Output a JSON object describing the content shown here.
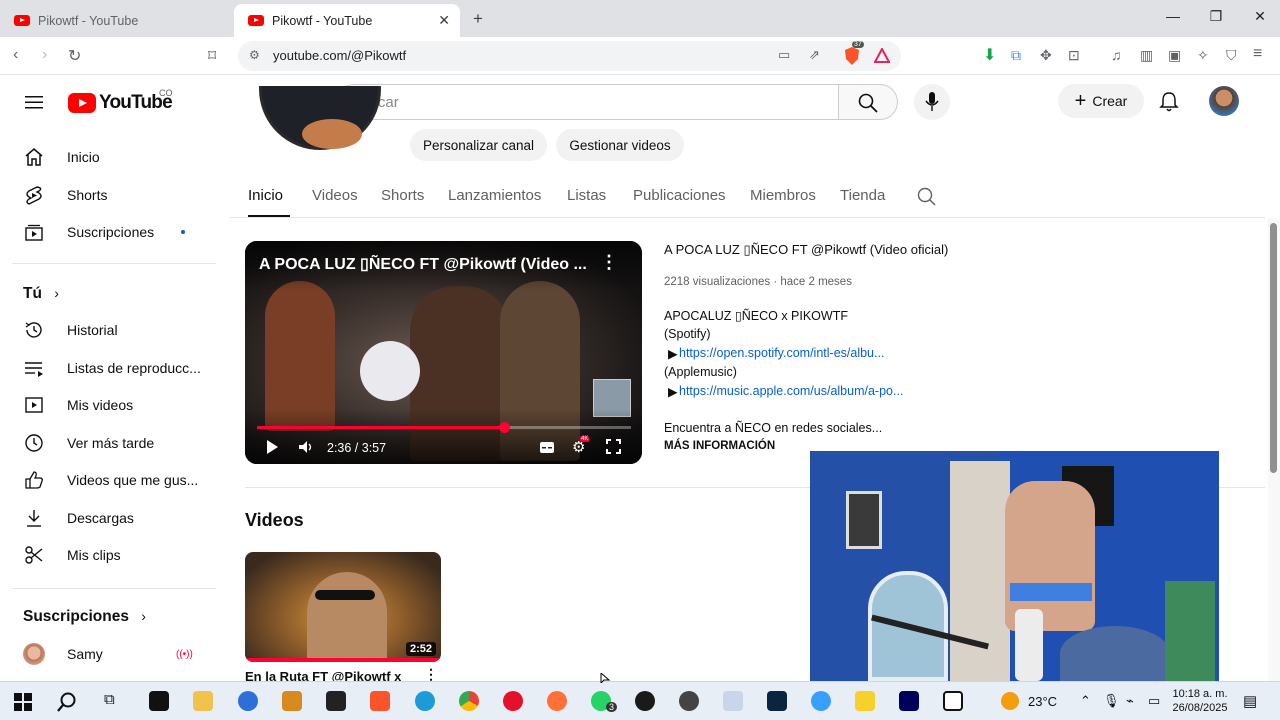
{
  "browser": {
    "tabs": [
      {
        "title": "Pikowtf - YouTube",
        "active": false
      },
      {
        "title": "Pikowtf - YouTube",
        "active": true
      }
    ],
    "url": "youtube.com/@Pikowtf",
    "extension_badge": "37"
  },
  "youtube": {
    "logo_text": "YouTube",
    "country_code": "CO",
    "search_placeholder": "Buscar",
    "create_label": "Crear",
    "colors": {
      "brand": "#ff0000",
      "progress": "#ff0033",
      "link": "#065fd4"
    }
  },
  "sidebar": {
    "top": [
      {
        "label": "Inicio",
        "icon": "home-icon"
      },
      {
        "label": "Shorts",
        "icon": "shorts-icon"
      },
      {
        "label": "Suscripciones",
        "icon": "subscriptions-icon"
      }
    ],
    "you_header": "Tú",
    "you": [
      {
        "label": "Historial",
        "icon": "history-icon"
      },
      {
        "label": "Listas de reproducc...",
        "icon": "playlists-icon"
      },
      {
        "label": "Mis videos",
        "icon": "my-videos-icon"
      },
      {
        "label": "Ver más tarde",
        "icon": "watch-later-icon"
      },
      {
        "label": "Videos que me gus...",
        "icon": "like-icon"
      },
      {
        "label": "Descargas",
        "icon": "download-icon"
      },
      {
        "label": "Mis clips",
        "icon": "clips-icon"
      }
    ],
    "subs_header": "Suscripciones",
    "subs": [
      {
        "label": "Samy",
        "live": true
      }
    ]
  },
  "channel": {
    "buttons": [
      "Personalizar canal",
      "Gestionar videos"
    ],
    "tabs": [
      "Inicio",
      "Videos",
      "Shorts",
      "Lanzamientos",
      "Listas",
      "Publicaciones",
      "Miembros",
      "Tienda"
    ],
    "active_tab": "Inicio"
  },
  "featured": {
    "player_title": "A POCA LUZ ▯ÑECO FT @Pikowtf (Video ...",
    "time": "2:36 / 3:57",
    "progress": 0.66,
    "title": "A POCA LUZ ▯ÑECO FT @Pikowtf (Video oficial)",
    "views": "2218 visualizaciones",
    "age": "hace 2 meses",
    "desc_lines": [
      "APOCALUZ ▯ÑECO x PIKOWTF",
      "(Spotify)"
    ],
    "spotify_link": "https://open.spotify.com/intl-es/albu...",
    "apple_label": "(Applemusic)",
    "apple_link": "https://music.apple.com/us/album/a-po...",
    "social": "Encuentra a ÑECO en redes sociales...",
    "more": "MÁS INFORMACIÓN"
  },
  "videos_section": {
    "heading": "Videos",
    "items": [
      {
        "title": "En la Ruta FT @Pikowtf x",
        "duration": "2:52"
      }
    ]
  },
  "taskbar": {
    "weather": "23°C",
    "time": "10:18 a. m.",
    "date": "26/08/2025",
    "whatsapp_badge": "3"
  }
}
